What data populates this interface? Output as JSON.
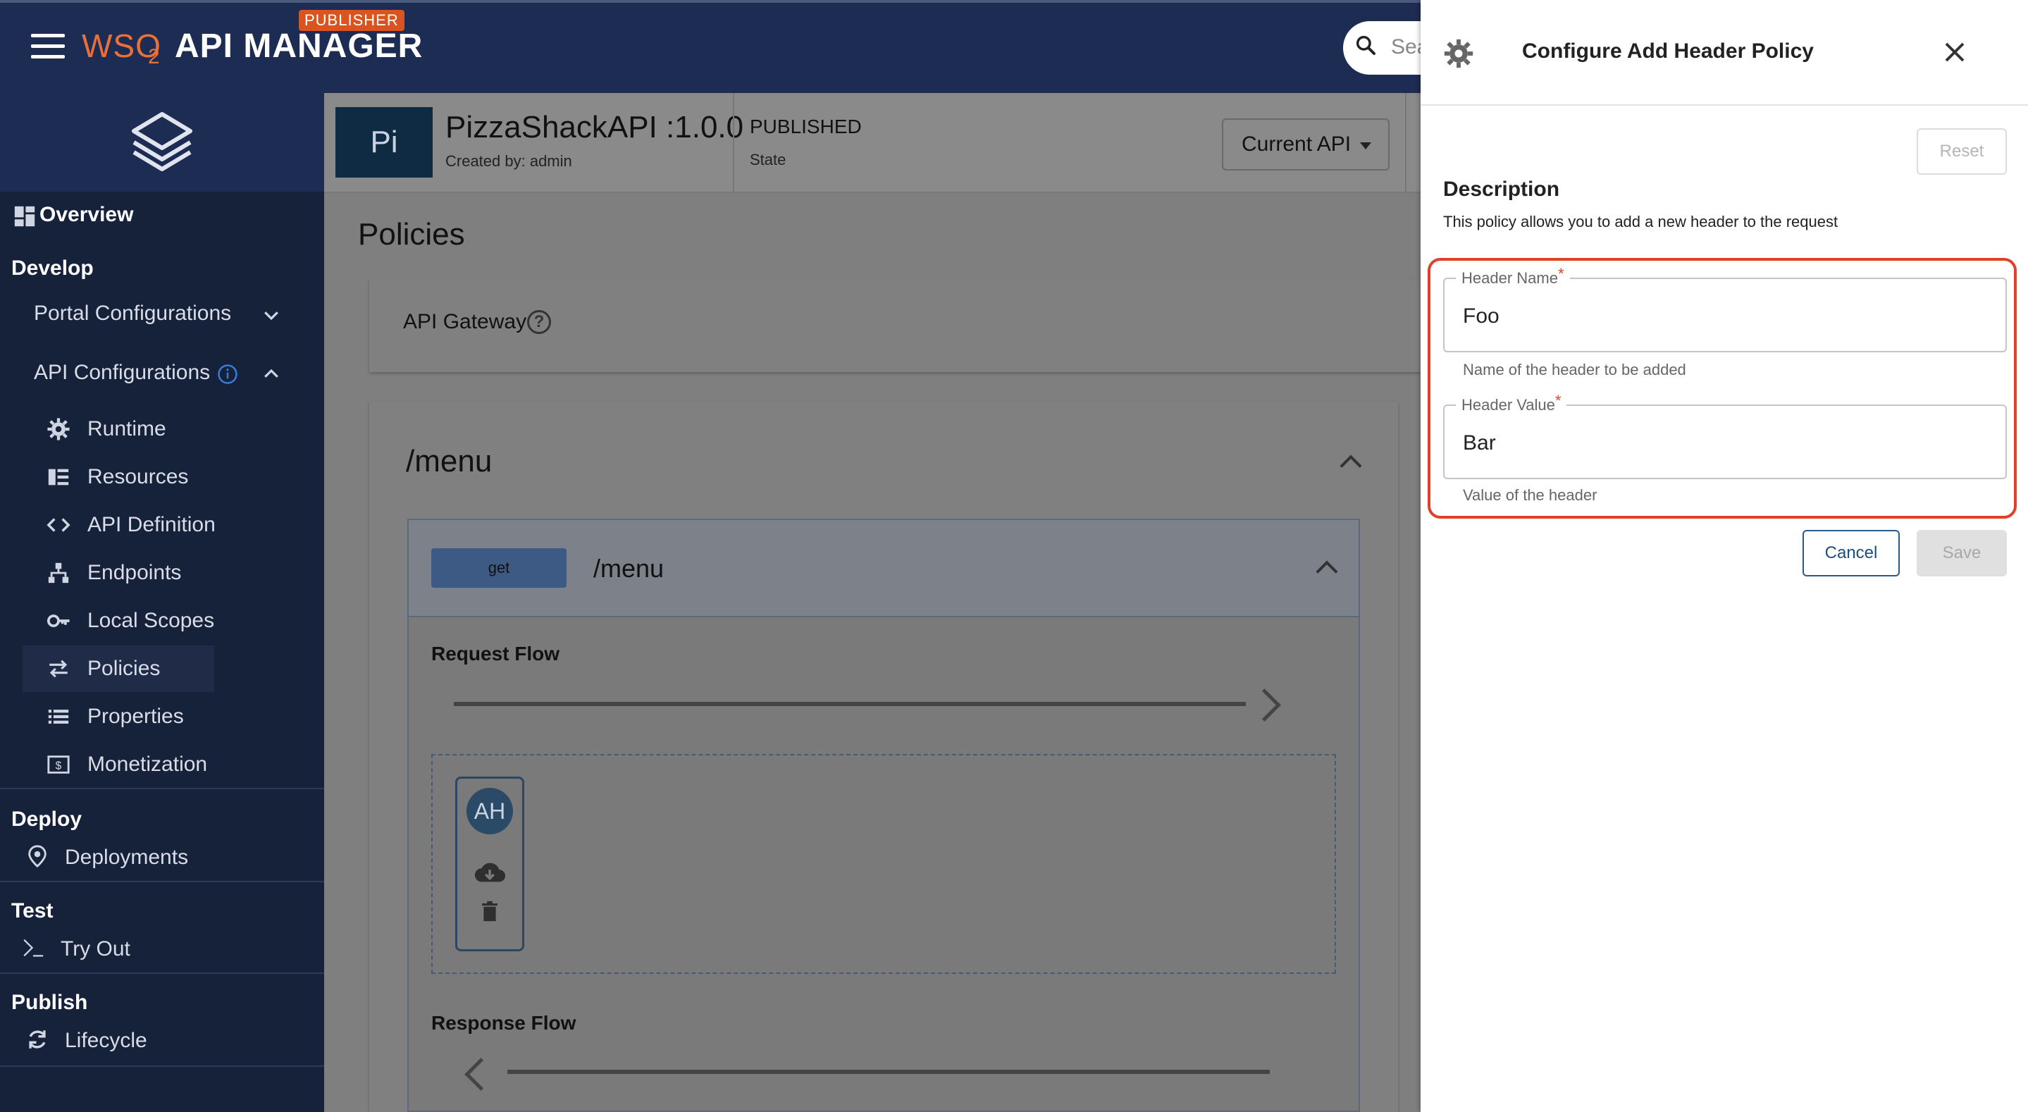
{
  "topbar": {
    "logo_text": "WSO",
    "logo_sub": "2",
    "app_name": "API MANAGER",
    "badge": "PUBLISHER",
    "search_placeholder": "Sea"
  },
  "sidebar": {
    "overview": "Overview",
    "develop": "Develop",
    "portal_configurations": "Portal Configurations",
    "api_configurations": "API Configurations",
    "items": [
      "Runtime",
      "Resources",
      "API Definition",
      "Endpoints",
      "Local Scopes",
      "Policies",
      "Properties",
      "Monetization"
    ],
    "deploy": "Deploy",
    "deployments": "Deployments",
    "test": "Test",
    "try_out": "Try Out",
    "publish": "Publish",
    "lifecycle": "Lifecycle"
  },
  "api": {
    "thumb": "Pi",
    "title": "PizzaShackAPI :1.0.0",
    "created_by": "Created by: admin",
    "state_value": "PUBLISHED",
    "state_label": "State",
    "version_select": "Current API"
  },
  "main": {
    "title": "Policies",
    "gateway_label": "API Gateway",
    "resource_path": "/menu",
    "operation": {
      "method": "get",
      "path": "/menu"
    },
    "request_flow": "Request Flow",
    "response_flow": "Response Flow",
    "policy_chip": "AH"
  },
  "drawer": {
    "title": "Configure Add Header Policy",
    "reset": "Reset",
    "description_title": "Description",
    "description_text": "This policy allows you to add a new header to the request",
    "header_name": {
      "label": "Header Name",
      "required_marker": "*",
      "value": "Foo",
      "help": "Name of the header to be added"
    },
    "header_value": {
      "label": "Header Value",
      "required_marker": "*",
      "value": "Bar",
      "help": "Value of the header"
    },
    "cancel": "Cancel",
    "save": "Save"
  },
  "colors": {
    "topbar": "#1c2c52",
    "sidebar": "#16213a",
    "brand_orange": "#e8703a",
    "highlight_red": "#e0402a",
    "primary_blue": "#1b4f82"
  }
}
